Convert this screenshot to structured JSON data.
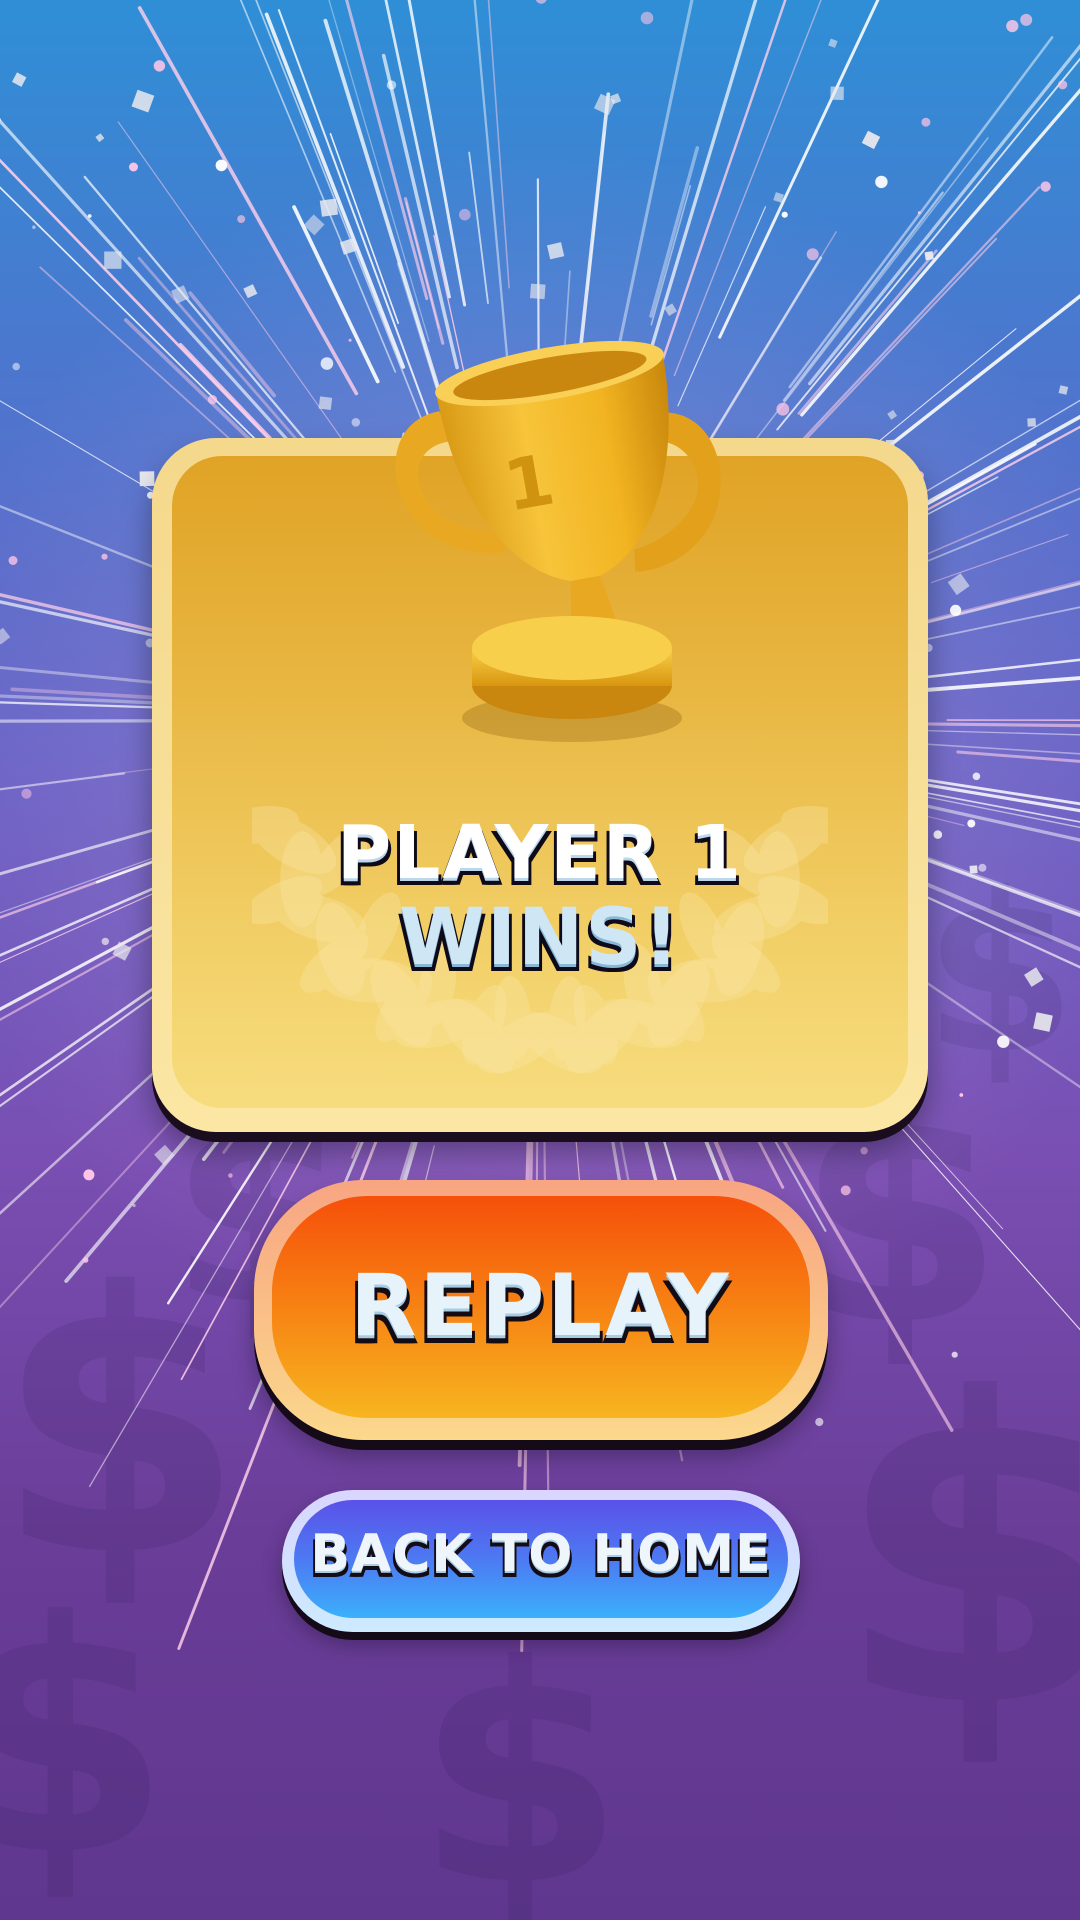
{
  "screen": "game-over",
  "result": {
    "line1": "PLAYER 1",
    "line2": "WINS!",
    "trophy_rank": "1"
  },
  "buttons": {
    "replay": "REPLAY",
    "home": "BACK TO HOME"
  },
  "colors": {
    "card_gold": "#e8b641",
    "replay_orange": "#f77d12",
    "home_blue": "#4d79f2",
    "background_top": "#2f8fd6",
    "background_bottom": "#5f378e"
  },
  "icons": {
    "trophy": "trophy-icon",
    "laurel": "laurel-wreath-icon",
    "background_symbol": "dollar-sign-icon",
    "effect": "fireworks"
  }
}
